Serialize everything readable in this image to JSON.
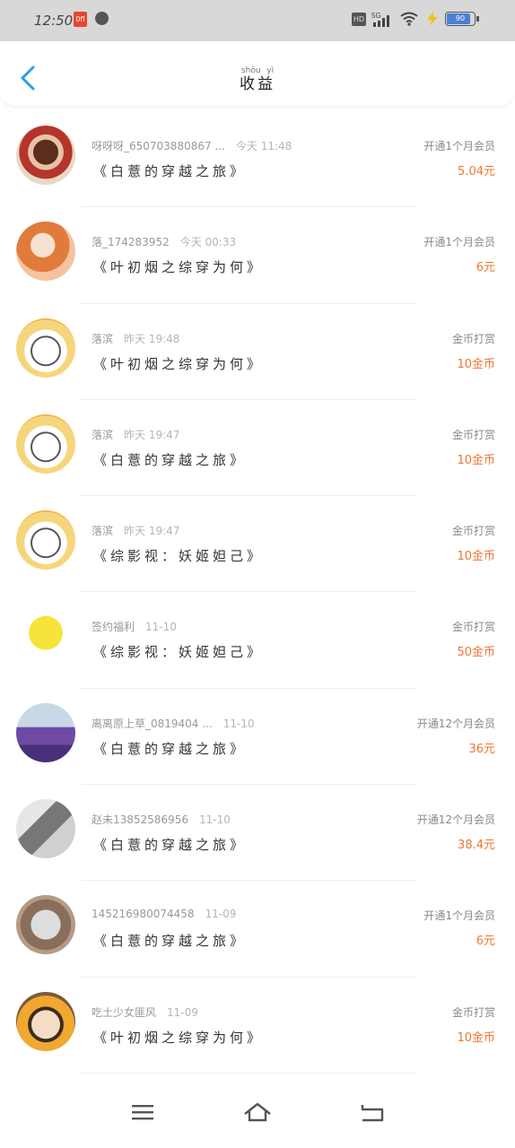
{
  "status_bar": {
    "time": "12:50",
    "app_icon": "0fl",
    "hd": "HD",
    "network": "5G",
    "battery_level": 0.9,
    "battery_label": "90",
    "icons": [
      "app-icon",
      "gauge-icon",
      "hd-icon",
      "signal-icon",
      "wifi-icon",
      "charge-icon",
      "battery-icon"
    ]
  },
  "header": {
    "title": "收益",
    "title_pinyin": [
      "shōu",
      "yì"
    ],
    "back_icon": "chevron-left-icon"
  },
  "colors": {
    "accent": "#f0762f",
    "back": "#2f9be8"
  },
  "items": [
    {
      "name": "呀呀呀_650703880867 ...",
      "time": "今天 11:48",
      "book": "《白薏的穿越之旅》",
      "type": "开通1个月会员",
      "amount": "5.04元"
    },
    {
      "name": "落_174283952",
      "time": "今天 00:33",
      "book": "《叶初烟之综穿为何》",
      "type": "开通1个月会员",
      "amount": "6元"
    },
    {
      "name": "落滨",
      "time": "昨天 19:48",
      "book": "《叶初烟之综穿为何》",
      "type": "金币打赏",
      "amount": "10金币"
    },
    {
      "name": "落滨",
      "time": "昨天 19:47",
      "book": "《白薏的穿越之旅》",
      "type": "金币打赏",
      "amount": "10金币"
    },
    {
      "name": "落滨",
      "time": "昨天 19:47",
      "book": "《综影视：妖姬妲己》",
      "type": "金币打赏",
      "amount": "10金币"
    },
    {
      "name": "签约福利",
      "time": "11-10",
      "book": "《综影视：妖姬妲己》",
      "type": "金币打赏",
      "amount": "50金币"
    },
    {
      "name": "离离原上草_0819404 ...",
      "time": "11-10",
      "book": "《白薏的穿越之旅》",
      "type": "开通12个月会员",
      "amount": "36元"
    },
    {
      "name": "赵未13852586956",
      "time": "11-10",
      "book": "《白薏的穿越之旅》",
      "type": "开通12个月会员",
      "amount": "38.4元"
    },
    {
      "name": "145216980074458",
      "time": "11-09",
      "book": "《白薏的穿越之旅》",
      "type": "开通1个月会员",
      "amount": "6元"
    },
    {
      "name": "吃土少女匪风",
      "time": "11-09",
      "book": "《叶初烟之综穿为何》",
      "type": "金币打赏",
      "amount": "10金币"
    }
  ],
  "nav": {
    "icons": [
      "menu-icon",
      "home-icon",
      "back-icon"
    ]
  }
}
